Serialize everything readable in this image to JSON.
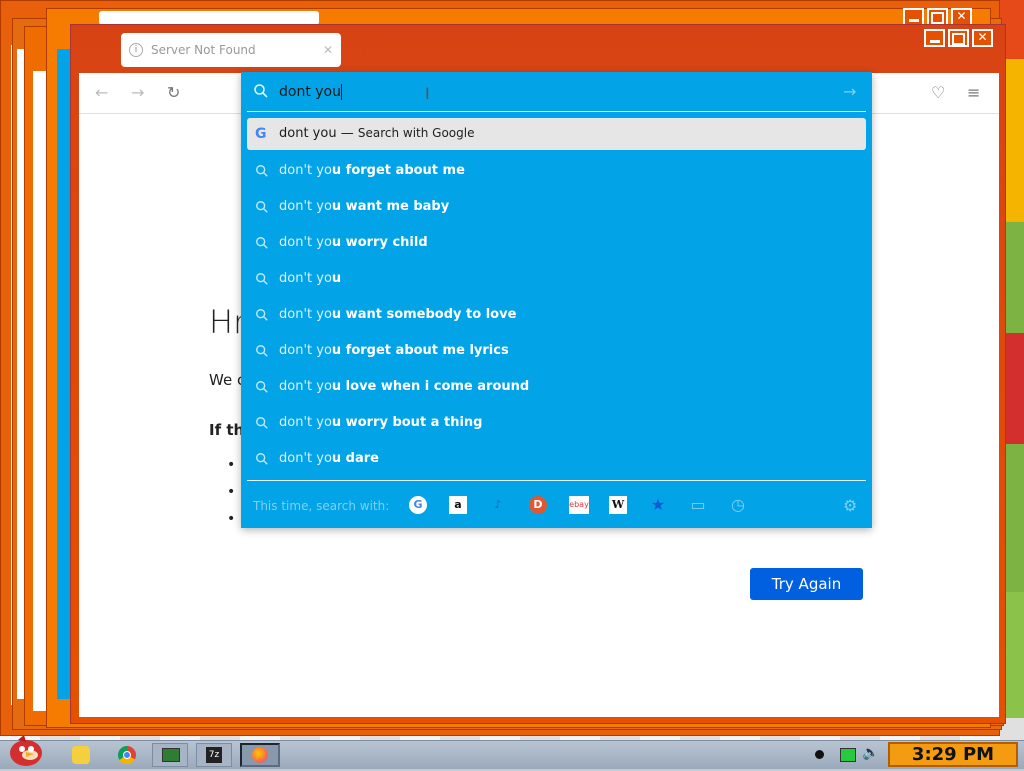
{
  "tab": {
    "title": "Server Not Found"
  },
  "search": {
    "query": "dont you",
    "google_row": {
      "query": "dont you",
      "dash": "—",
      "action": "Search with Google"
    },
    "suggestions": [
      {
        "typed": "don't yo",
        "rest": "u forget about me"
      },
      {
        "typed": "don't yo",
        "rest": "u want me baby"
      },
      {
        "typed": "don't yo",
        "rest": "u worry child"
      },
      {
        "typed": "don't yo",
        "rest": "u"
      },
      {
        "typed": "don't yo",
        "rest": "u want somebody to love"
      },
      {
        "typed": "don't yo",
        "rest": "u forget about me lyrics"
      },
      {
        "typed": "don't yo",
        "rest": "u love when i come around"
      },
      {
        "typed": "don't yo",
        "rest": "u worry bout a thing"
      },
      {
        "typed": "don't yo",
        "rest": "u dare"
      }
    ],
    "oneoff_label": "This time, search with:",
    "engines": [
      "G",
      "a",
      "♪",
      "D",
      "ebay",
      "W",
      "★",
      "▭",
      "◷"
    ]
  },
  "page": {
    "heading": "Hr",
    "text": "We c",
    "bold": "If th",
    "bullets": [
      "•",
      "•",
      "•"
    ],
    "try_again": "Try Again"
  },
  "taskbar": {
    "clock": "3:29 PM"
  },
  "colors": {
    "dropdown": "#03a3e8",
    "window": "#e65100",
    "button": "#0060df"
  }
}
